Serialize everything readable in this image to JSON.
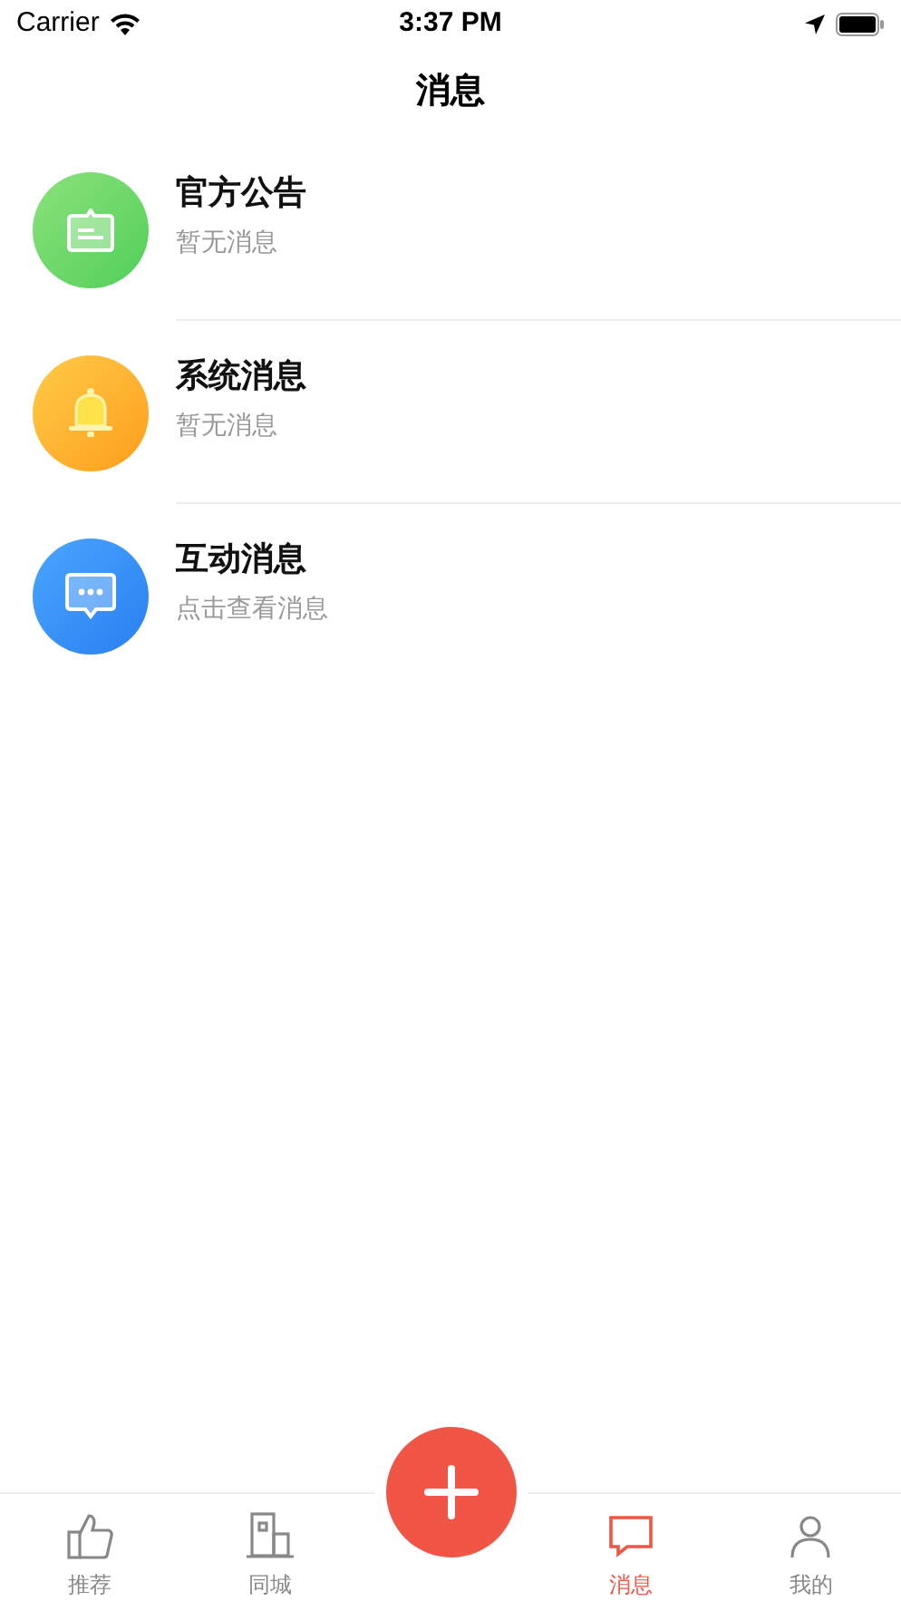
{
  "status_bar": {
    "carrier": "Carrier",
    "time": "3:37 PM"
  },
  "nav_bar": {
    "title": "消息"
  },
  "messages": [
    {
      "kind": "announcement",
      "title": "官方公告",
      "subtitle": "暂无消息"
    },
    {
      "kind": "system",
      "title": "系统消息",
      "subtitle": "暂无消息"
    },
    {
      "kind": "interaction",
      "title": "互动消息",
      "subtitle": "点击查看消息"
    }
  ],
  "tab_bar": [
    {
      "kind": "recommend",
      "label": "推荐",
      "selected": false
    },
    {
      "kind": "city",
      "label": "同城",
      "selected": false
    },
    {
      "kind": "add"
    },
    {
      "kind": "messages",
      "label": "消息",
      "selected": true
    },
    {
      "kind": "profile",
      "label": "我的",
      "selected": false
    }
  ]
}
